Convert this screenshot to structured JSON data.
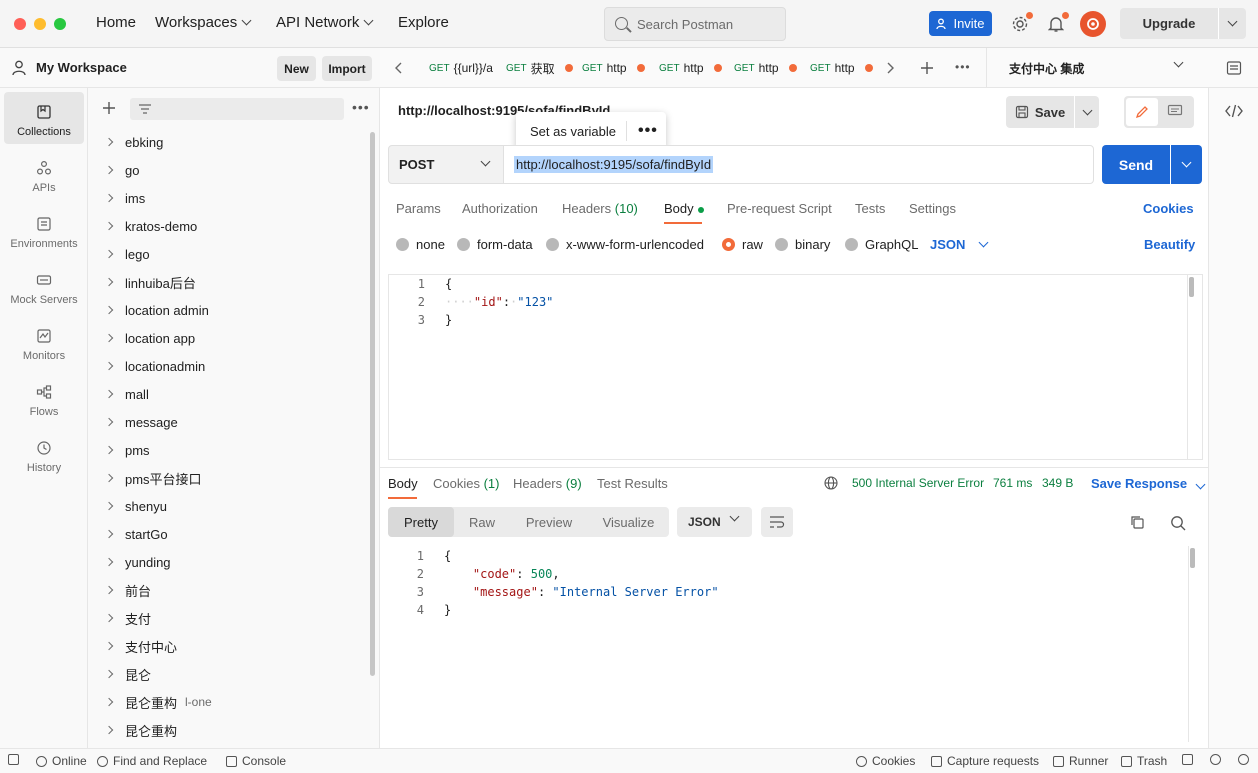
{
  "nav": {
    "home": "Home",
    "workspaces": "Workspaces",
    "api_network": "API Network",
    "explore": "Explore",
    "search_placeholder": "Search Postman",
    "invite": "Invite",
    "upgrade": "Upgrade"
  },
  "workspace": {
    "title": "My Workspace",
    "new_label": "New",
    "import_label": "Import"
  },
  "rail": [
    {
      "label": "Collections"
    },
    {
      "label": "APIs"
    },
    {
      "label": "Environments"
    },
    {
      "label": "Mock Servers"
    },
    {
      "label": "Monitors"
    },
    {
      "label": "Flows"
    },
    {
      "label": "History"
    }
  ],
  "collections": [
    {
      "name": "ebking"
    },
    {
      "name": "go"
    },
    {
      "name": "ims"
    },
    {
      "name": "kratos-demo"
    },
    {
      "name": "lego"
    },
    {
      "name": "linhuiba后台"
    },
    {
      "name": "location admin"
    },
    {
      "name": "location app"
    },
    {
      "name": "locationadmin"
    },
    {
      "name": "mall"
    },
    {
      "name": "message"
    },
    {
      "name": "pms"
    },
    {
      "name": "pms平台接口"
    },
    {
      "name": "shenyu"
    },
    {
      "name": "startGo"
    },
    {
      "name": "yunding"
    },
    {
      "name": "前台"
    },
    {
      "name": "支付"
    },
    {
      "name": "支付中心"
    },
    {
      "name": "昆仑"
    },
    {
      "name": "昆仑重构",
      "fork": "l-one"
    },
    {
      "name": "昆仑重构"
    }
  ],
  "tabs": [
    {
      "method": "GET",
      "title": "{{url}}/a"
    },
    {
      "method": "GET",
      "title": "获取"
    },
    {
      "method": "GET",
      "title": "http"
    },
    {
      "method": "GET",
      "title": "http"
    },
    {
      "method": "GET",
      "title": "http"
    },
    {
      "method": "GET",
      "title": "http"
    }
  ],
  "environment": "支付中心 集成",
  "request": {
    "name": "http://localhost:9195/sofa/findById",
    "popover_label": "Set as variable",
    "save_label": "Save",
    "method": "POST",
    "url": "http://localhost:9195/sofa/findById",
    "send_label": "Send",
    "subtabs": {
      "params": "Params",
      "authorization": "Authorization",
      "headers": "Headers",
      "headers_count": "(10)",
      "body": "Body",
      "prerequest": "Pre-request Script",
      "tests": "Tests",
      "settings": "Settings",
      "cookies": "Cookies"
    },
    "body_types": {
      "none": "none",
      "form_data": "form-data",
      "urlencoded": "x-www-form-urlencoded",
      "raw": "raw",
      "binary": "binary",
      "graphql": "GraphQL",
      "json": "JSON",
      "beautify": "Beautify"
    },
    "body_lines": [
      {
        "n": "1",
        "open": "{"
      },
      {
        "n": "2",
        "key": "\"id\"",
        "val": "\"123\""
      },
      {
        "n": "3",
        "open": "}"
      }
    ]
  },
  "response": {
    "tabs": {
      "body": "Body",
      "cookies": "Cookies",
      "cookies_count": "(1)",
      "headers": "Headers",
      "headers_count": "(9)",
      "test_results": "Test Results"
    },
    "status": "500 Internal Server Error",
    "time": "761 ms",
    "size": "349 B",
    "save_response": "Save Response",
    "views": {
      "pretty": "Pretty",
      "raw": "Raw",
      "preview": "Preview",
      "visualize": "Visualize"
    },
    "format": "JSON",
    "lines": {
      "l1n": "1",
      "l1": "{",
      "l2n": "2",
      "l2k": "\"code\"",
      "l2v": "500",
      "l3n": "3",
      "l3k": "\"message\"",
      "l3v": "\"Internal Server Error\"",
      "l4n": "4",
      "l4": "}"
    }
  },
  "statusbar": {
    "online": "Online",
    "find_replace": "Find and Replace",
    "console": "Console",
    "cookies": "Cookies",
    "capture": "Capture requests",
    "runner": "Runner",
    "trash": "Trash"
  },
  "colors": {
    "accent_orange": "#f26b3a",
    "primary_blue": "#1d67d4",
    "status_green": "#0b7f3f"
  }
}
